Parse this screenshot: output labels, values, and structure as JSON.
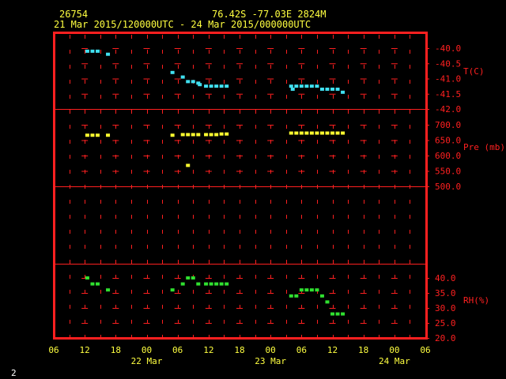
{
  "header": {
    "station_id": "26754",
    "location": "76.42S   -77.03E   2824M",
    "period": "21 Mar 2015/120000UTC - 24 Mar 2015/000000UTC"
  },
  "footer": {
    "page_number": "2"
  },
  "colors": {
    "frame": "#ff2020",
    "temperature": "#40e0f0",
    "pressure": "#ffff30",
    "humidity": "#30e030",
    "text": "#ffff40"
  },
  "chart_data": [
    {
      "type": "scatter",
      "ylabel": "T(C)",
      "ylim": [
        -42.0,
        -39.75
      ],
      "yticks": [
        "-40.0",
        "-40.5",
        "-41.0",
        "-41.5",
        "-42.0"
      ],
      "ytick_values": [
        -40.0,
        -40.5,
        -41.0,
        -41.5,
        -42.0
      ],
      "series": [
        {
          "color": "#40e0f0",
          "points": [
            [
              12.5,
              -40.1
            ],
            [
              13.5,
              -40.1
            ],
            [
              14.5,
              -40.1
            ],
            [
              16.5,
              -40.2
            ],
            [
              29,
              -40.8
            ],
            [
              31,
              -40.95
            ],
            [
              32,
              -41.1
            ],
            [
              33,
              -41.1
            ],
            [
              34,
              -41.15
            ],
            [
              34.3,
              -41.2
            ],
            [
              35.5,
              -41.25
            ],
            [
              36.5,
              -41.25
            ],
            [
              37.5,
              -41.25
            ],
            [
              38.5,
              -41.25
            ],
            [
              39.5,
              -41.25
            ],
            [
              52,
              -41.25
            ],
            [
              52.3,
              -41.35
            ],
            [
              53,
              -41.25
            ],
            [
              54,
              -41.25
            ],
            [
              55,
              -41.25
            ],
            [
              56,
              -41.25
            ],
            [
              57,
              -41.25
            ],
            [
              58,
              -41.35
            ],
            [
              59,
              -41.35
            ],
            [
              60,
              -41.35
            ],
            [
              61,
              -41.35
            ],
            [
              62,
              -41.45
            ]
          ]
        }
      ]
    },
    {
      "type": "scatter",
      "ylabel": "Pre (mb)",
      "ylim": [
        500.0,
        720.0
      ],
      "yticks": [
        "700.0",
        "650.0",
        "600.0",
        "550.0",
        "500.0"
      ],
      "ytick_values": [
        700,
        650,
        600,
        550,
        500
      ],
      "series": [
        {
          "color": "#ffff30",
          "points": [
            [
              12.5,
              666
            ],
            [
              13.5,
              666
            ],
            [
              14.5,
              666
            ],
            [
              16.5,
              666
            ],
            [
              29,
              666
            ],
            [
              31,
              668
            ],
            [
              32,
              668
            ],
            [
              33,
              668
            ],
            [
              34,
              668
            ],
            [
              35.5,
              668
            ],
            [
              36.5,
              668
            ],
            [
              37.5,
              668
            ],
            [
              38.5,
              670
            ],
            [
              39.5,
              670
            ],
            [
              32,
              568
            ],
            [
              52,
              673
            ],
            [
              53,
              673
            ],
            [
              54,
              673
            ],
            [
              55,
              673
            ],
            [
              56,
              673
            ],
            [
              57,
              673
            ],
            [
              58,
              673
            ],
            [
              59,
              673
            ],
            [
              60,
              673
            ],
            [
              61,
              673
            ],
            [
              62,
              673
            ]
          ]
        }
      ]
    },
    {
      "type": "scatter",
      "ylabel": "RH(%)",
      "ylim": [
        20.0,
        40.0
      ],
      "yticks": [
        "40.0",
        "35.0",
        "30.0",
        "25.0",
        "20.0"
      ],
      "ytick_values": [
        40,
        35,
        30,
        25,
        20
      ],
      "series": [
        {
          "color": "#30e030",
          "points": [
            [
              12.5,
              40
            ],
            [
              13.5,
              38
            ],
            [
              14.5,
              38
            ],
            [
              16.5,
              36
            ],
            [
              29,
              36
            ],
            [
              31,
              38
            ],
            [
              32,
              40
            ],
            [
              33,
              40
            ],
            [
              34,
              38
            ],
            [
              35.5,
              38
            ],
            [
              36.5,
              38
            ],
            [
              37.5,
              38
            ],
            [
              38.5,
              38
            ],
            [
              39.5,
              38
            ],
            [
              52,
              34
            ],
            [
              53,
              34
            ],
            [
              54,
              36
            ],
            [
              55,
              36
            ],
            [
              56,
              36
            ],
            [
              57,
              36
            ],
            [
              58,
              34
            ],
            [
              59,
              32
            ],
            [
              60,
              28
            ],
            [
              61,
              28
            ],
            [
              62,
              28
            ]
          ]
        }
      ]
    }
  ],
  "xaxis": {
    "ticks": [
      {
        "h": 6,
        "label": "06"
      },
      {
        "h": 12,
        "label": "12"
      },
      {
        "h": 18,
        "label": "18"
      },
      {
        "h": 24,
        "label": "00"
      },
      {
        "h": 30,
        "label": "06"
      },
      {
        "h": 36,
        "label": "12"
      },
      {
        "h": 42,
        "label": "18"
      },
      {
        "h": 48,
        "label": "00"
      },
      {
        "h": 54,
        "label": "06"
      },
      {
        "h": 60,
        "label": "12"
      },
      {
        "h": 66,
        "label": "18"
      },
      {
        "h": 72,
        "label": "00"
      },
      {
        "h": 78,
        "label": "06"
      }
    ],
    "day_labels": [
      {
        "h": 24,
        "label": "22 Mar"
      },
      {
        "h": 48,
        "label": "23 Mar"
      },
      {
        "h": 72,
        "label": "24 Mar"
      }
    ]
  }
}
